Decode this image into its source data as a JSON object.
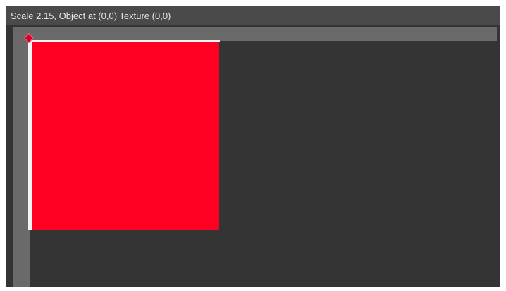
{
  "window": {
    "title": "Scale 2.15, Object at (0,0) Texture (0,0)"
  },
  "icons": {
    "origin_marker": "origin-diamond-icon"
  },
  "colors": {
    "panel_background": "#343434",
    "title_background": "#4a4a4a",
    "ruler": "#6a6a6a",
    "texture_fill": "#ff0022",
    "texture_edge": "#f4f4f4",
    "origin_marker": "#d6002e",
    "title_text": "#e6e6e6"
  }
}
